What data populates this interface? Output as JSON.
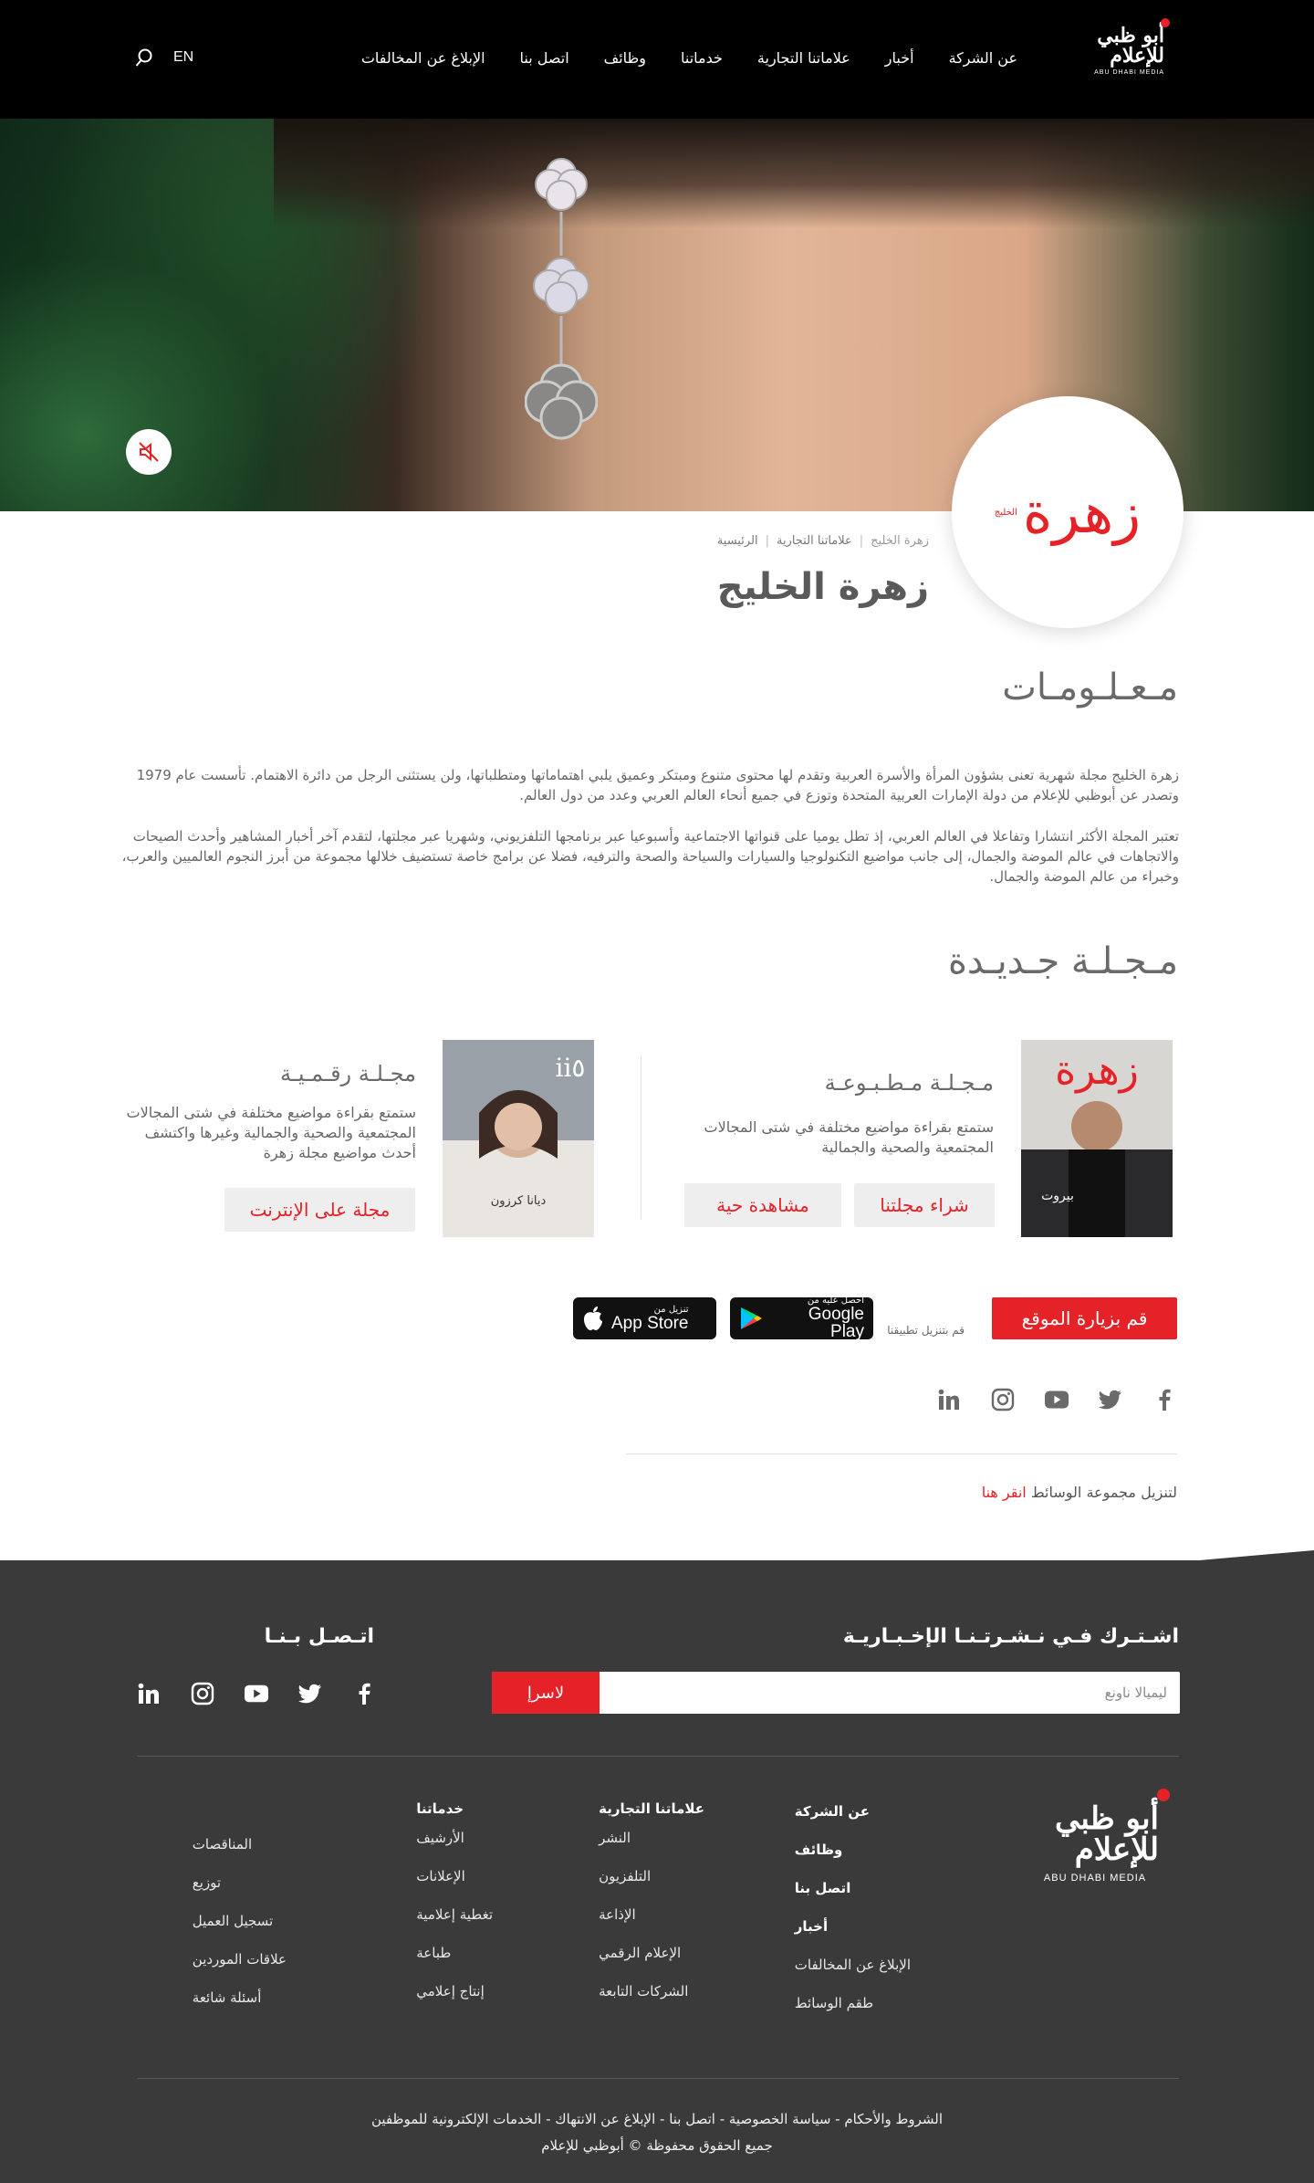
{
  "header": {
    "logo_ar": "أبو ظبي للإعلام",
    "logo_en": "ABU DHABI MEDIA",
    "nav": [
      "عن الشركة",
      "أخبار",
      "علاماتنا التجارية",
      "خدماتنا",
      "وظائف",
      "اتصل بنا",
      "الإبلاغ عن المخالفات"
    ],
    "lang": "EN"
  },
  "brand": {
    "logo_word": "زهرة",
    "logo_small": "الخليج"
  },
  "breadcrumb": {
    "home": "الرئيسية",
    "brands": "علاماتنا التجارية",
    "current": "زهرة الخليج"
  },
  "page_title": "زهرة الخليج",
  "info": {
    "title": "مـعـلـومـات",
    "p1": "زهرة الخليج مجلة شهرية تعنى بشؤون المرأة والأسرة العربية وتقدم لها محتوى متنوع ومبتكر وعميق يلبي اهتماماتها ومتطلباتها، ولن يستثنى الرجل من دائرة الاهتمام. تأسست عام 1979 وتصدر عن أبوظبي للإعلام من دولة الإمارات العربية المتحدة وتوزع في جميع أنحاء العالم العربي وعدد من دول العالم.",
    "p2": "تعتبر المجلة الأكثر انتشارا وتفاعلا في العالم العربي، إذ تطل يوميا على قنواتها الاجتماعية وأسبوعيا عبر برنامجها التلفزيوني، وشهريا عبر مجلتها، لتقدم آخر أخبار المشاهير وأحدث الصيحات والاتجاهات في عالم الموضة والجمال، إلى جانب مواضيع التكنولوجيا والسيارات والسياحة والصحة والترفيه، فضلا عن برامج خاصة تستضيف خلالها مجموعة من أبرز النجوم العالميين والعرب، وخبراء من عالم الموضة والجمال."
  },
  "new_mag": {
    "title": "مـجـلـة جـديـدة",
    "print": {
      "title": "مـجـلـة مـطـبـوعـة",
      "desc": "ستمتع بقراءة مواضيع مختلفة في شتى المجالات المجتمعية والصحية والجمالية",
      "buy": "شراء مجلتنا",
      "live": "مشاهدة حية",
      "cover_title": "زهرة",
      "cover_name": "بيروت"
    },
    "digital": {
      "title": "مجـلـة رقـمـيـة",
      "desc": "ستمتع بقراءة مواضيع مختلفة في شتى المجالات المجتمعية والصحية والجمالية وغيرها واكتشف أحدث مواضيع مجلة زهرة",
      "online": "مجلة على الإنترنت",
      "cover_name": "ديانا كرزون"
    }
  },
  "apps": {
    "visit": "قم بزيارة الموقع",
    "download_label": "قم بتنزيل تطبيقنا",
    "google_small": "احصل عليه من",
    "google_big": "Google Play",
    "apple_small": "تنزيل من",
    "apple_big": "App Store"
  },
  "media_kit": {
    "text": "لتنزيل مجموعة الوسائط",
    "link": "انقر هنا"
  },
  "footer": {
    "newsletter_title": "اشـتـرك فـي نـشـرتـنـا الإخـبـاريـة",
    "email_placeholder": "ليميالا ناونع",
    "subscribe": "لاسرإ",
    "contact_title": "اتـصـل بـنـا",
    "col_company": [
      "عن الشركة",
      "وظائف",
      "اتصل بنا",
      "أخبار",
      "الإبلاغ عن المخالفات",
      "طقم الوسائط"
    ],
    "col_brands_title": "علاماتنا التجارية",
    "col_brands": [
      "النشر",
      "التلفزيون",
      "الإذاعة",
      "الإعلام الرقمي",
      "الشركات التابعة"
    ],
    "col_services_title": "خدماتنا",
    "col_services": [
      "الأرشيف",
      "الإعلانات",
      "تغطية إعلامية",
      "طباعة",
      "إنتاج إعلامي"
    ],
    "col_extra": [
      "المناقصات",
      "توزيع",
      "تسجيل العميل",
      "علاقات الموردين",
      "أسئلة شائعة"
    ],
    "links": "الشروط والأحكام - سياسة الخصوصية - اتصل بنا - الإبلاغ عن الانتهاك - الخدمات الإلكترونية للموظفين",
    "copyright": "جميع الحقوق محفوظة © أبوظبي للإعلام",
    "logo_ar": "أبو ظبي للإعلام",
    "logo_en": "ABU DHABI MEDIA"
  },
  "colors": {
    "accent": "#e52228",
    "footer_bg": "#3a3a3a",
    "header_bg": "#000000"
  }
}
